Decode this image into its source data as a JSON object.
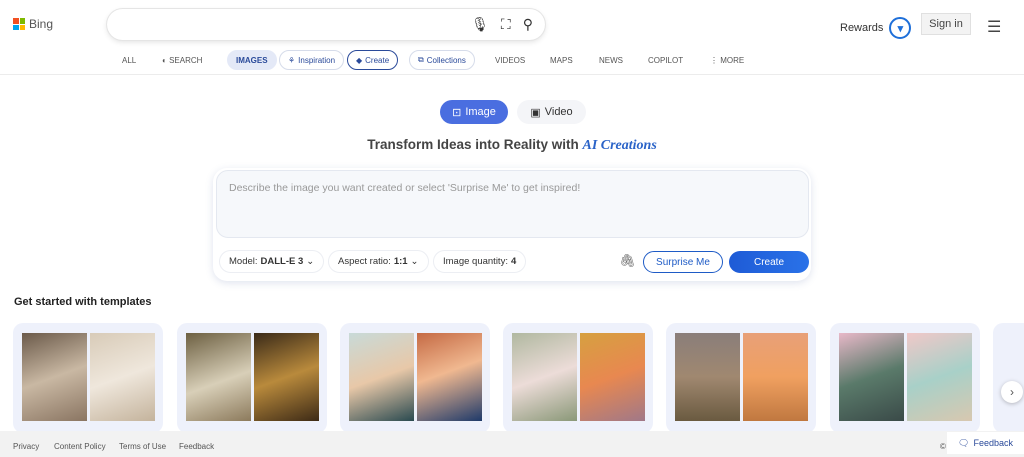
{
  "header": {
    "brand": "Bing",
    "rewards_label": "Rewards",
    "signin_label": "Sign in"
  },
  "nav": {
    "all": "ALL",
    "search": "SEARCH",
    "images": "IMAGES",
    "inspiration": "Inspiration",
    "create": "Create",
    "collections": "Collections",
    "videos": "VIDEOS",
    "maps": "MAPS",
    "news": "NEWS",
    "copilot": "COPILOT",
    "more": "MORE"
  },
  "mode_tabs": {
    "image": "Image",
    "video": "Video",
    "active": "Image"
  },
  "headline": {
    "text": "Transform Ideas into Reality with ",
    "emphasis": "AI Creations"
  },
  "prompt": {
    "placeholder": "Describe the image you want created or select 'Surprise Me' to get inspired!",
    "value": ""
  },
  "options": {
    "model_label": "Model:",
    "model_value": "DALL-E 3",
    "aspect_label": "Aspect ratio:",
    "aspect_value": "1:1",
    "quantity_label": "Image quantity:",
    "quantity_value": "4"
  },
  "actions": {
    "surprise": "Surprise Me",
    "create": "Create"
  },
  "templates": {
    "heading": "Get started with templates"
  },
  "footer": {
    "privacy": "Privacy",
    "content_policy": "Content Policy",
    "terms": "Terms of Use",
    "feedback": "Feedback",
    "copyright": "©",
    "feedback_button": "Feedback"
  },
  "colors": {
    "accent": "#1e5bd6",
    "tab_active": "#4a6ee0"
  }
}
